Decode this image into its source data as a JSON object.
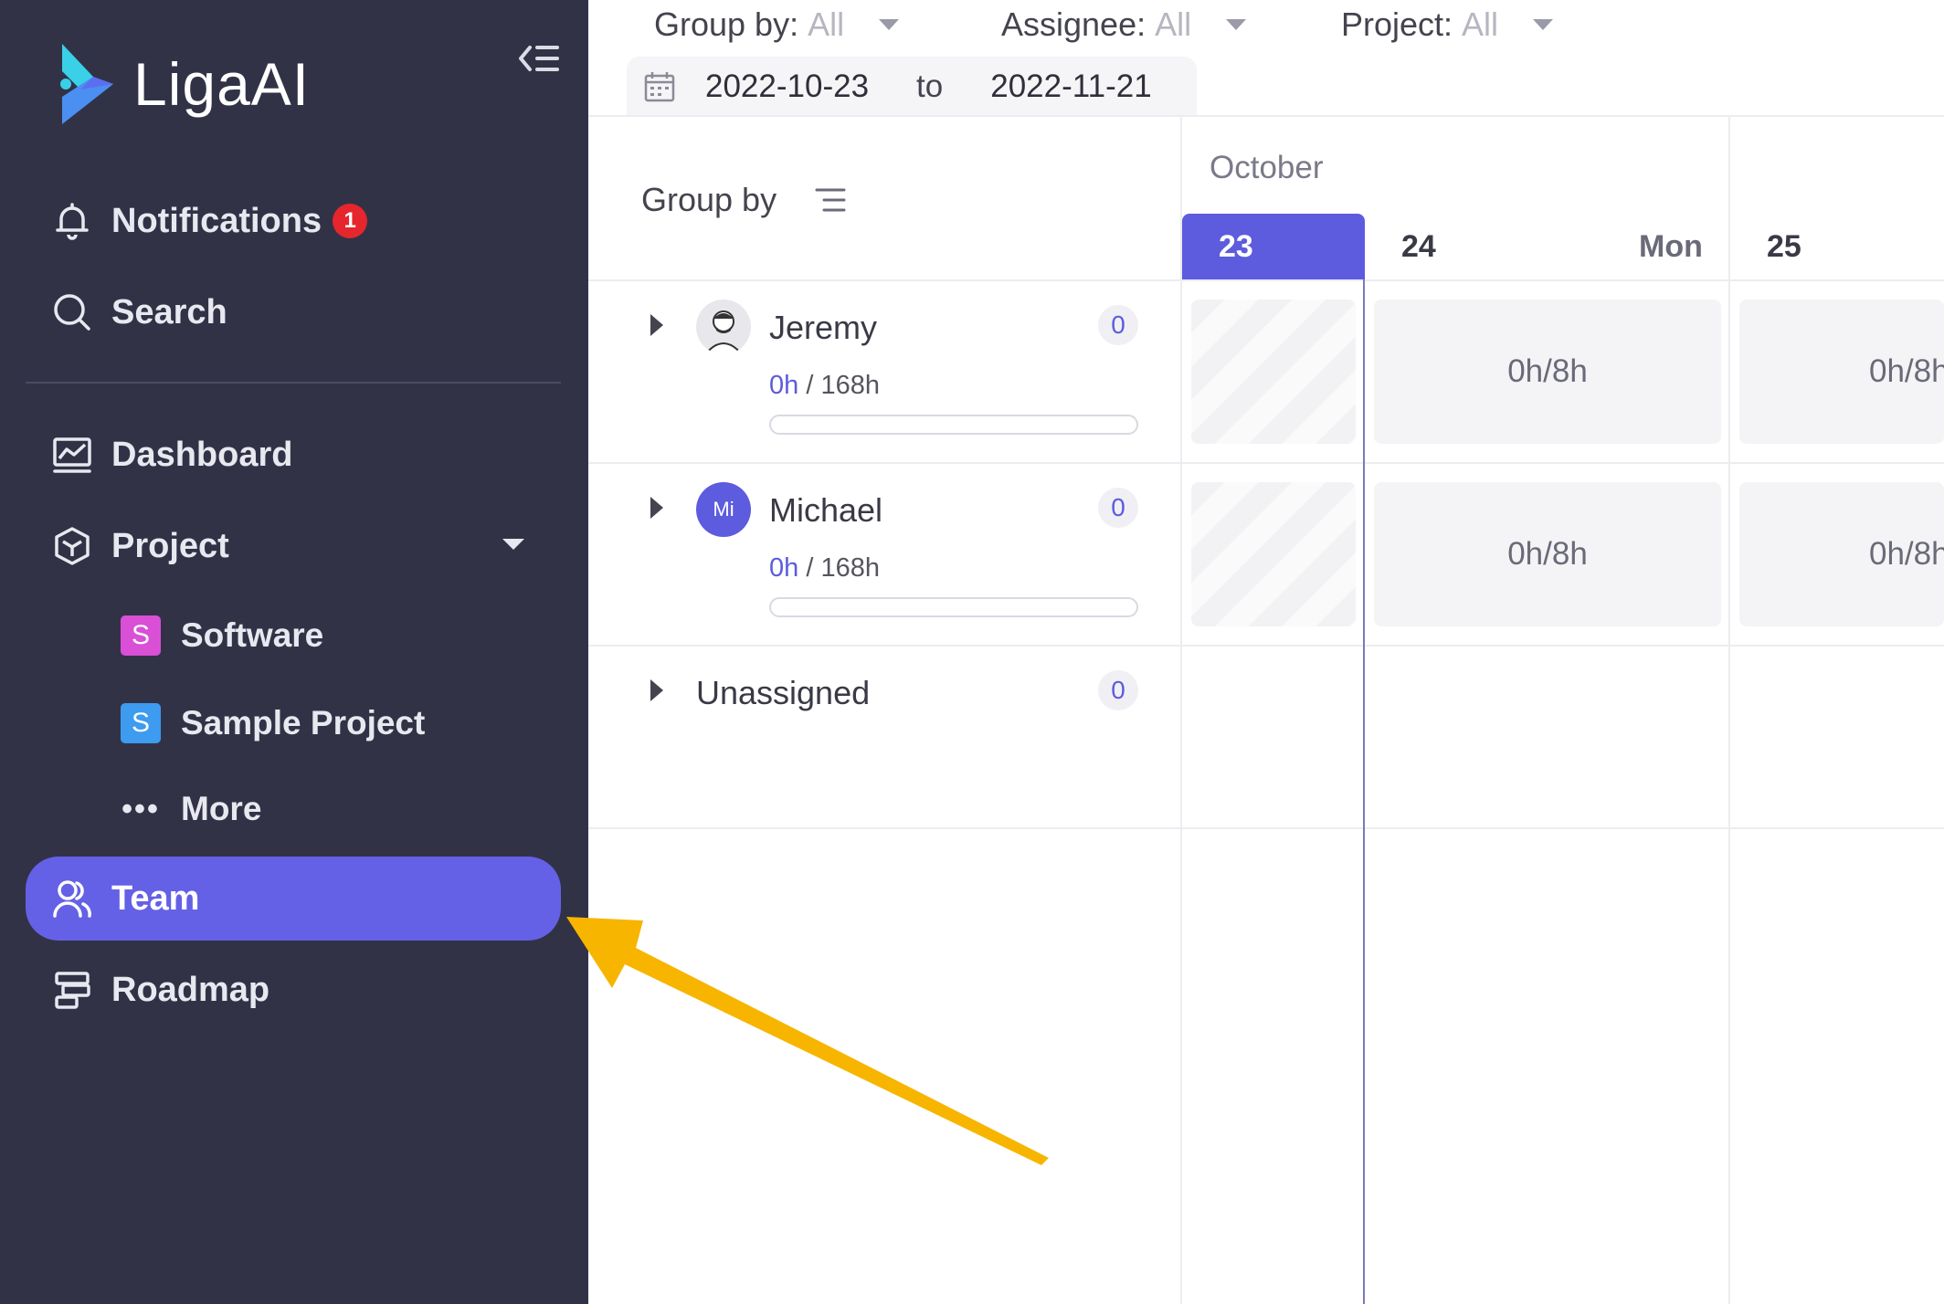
{
  "app": {
    "name": "LigaAI"
  },
  "sidebar": {
    "notifications": {
      "label": "Notifications",
      "badge": "1"
    },
    "search": {
      "label": "Search"
    },
    "dashboard": {
      "label": "Dashboard"
    },
    "project": {
      "label": "Project"
    },
    "projects": [
      {
        "initial": "S",
        "label": "Software",
        "color": "#d94fd6"
      },
      {
        "initial": "S",
        "label": "Sample Project",
        "color": "#3d9bf0"
      }
    ],
    "more": {
      "label": "More"
    },
    "team": {
      "label": "Team",
      "active": true
    },
    "roadmap": {
      "label": "Roadmap"
    },
    "colors": {
      "bg": "#323247",
      "active": "#6461e6"
    }
  },
  "filters": {
    "group_by": {
      "label": "Group by:",
      "value": "All"
    },
    "assignee": {
      "label": "Assignee:",
      "value": "All"
    },
    "project": {
      "label": "Project:",
      "value": "All"
    },
    "date_range": {
      "start": "2022-10-23",
      "separator": "to",
      "end": "2022-11-21"
    }
  },
  "panel": {
    "group_by_label": "Group by"
  },
  "members": [
    {
      "name": "Jeremy",
      "avatar": "photo",
      "used": "0h",
      "capacity": "/ 168h",
      "progress": 0,
      "count": "0"
    },
    {
      "name": "Michael",
      "avatar": "initials",
      "initials": "Mi",
      "used": "0h",
      "capacity": "/ 168h",
      "progress": 0,
      "count": "0"
    }
  ],
  "unassigned": {
    "label": "Unassigned",
    "count": "0"
  },
  "calendar": {
    "month": "October",
    "days": [
      {
        "num": "23",
        "sub": "",
        "today": true
      },
      {
        "num": "24",
        "sub": "Mon"
      },
      {
        "num": "25",
        "sub": ""
      }
    ],
    "cells": {
      "jeremy": [
        "",
        "0h/8h",
        "0h/8h"
      ],
      "michael": [
        "",
        "0h/8h",
        "0h/8h"
      ]
    }
  },
  "annotation": {
    "arrow_color": "#f7b500"
  }
}
